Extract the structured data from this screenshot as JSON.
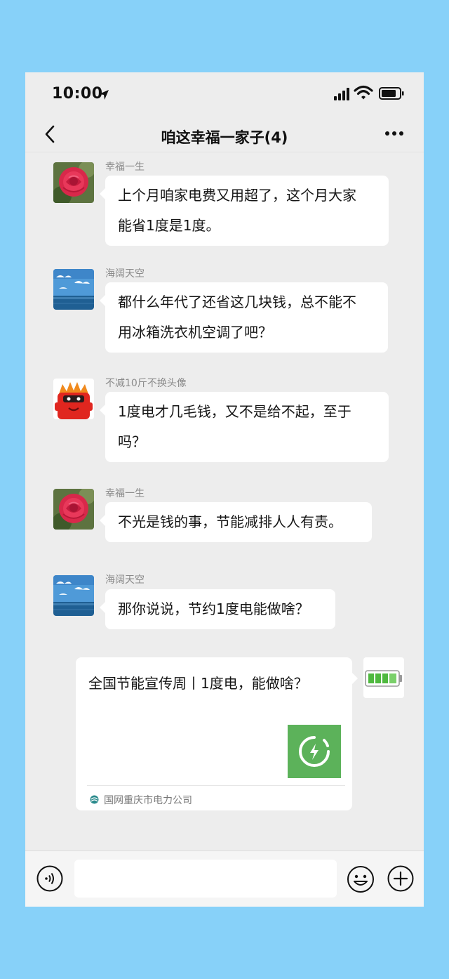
{
  "status_bar": {
    "time": "10:00",
    "icons": [
      "location-arrow-icon",
      "signal-icon",
      "wifi-icon",
      "battery-icon"
    ]
  },
  "header": {
    "title": "咱这幸福一家子(4)",
    "back_icon": "chevron-left-icon",
    "more_icon": "more-dots-icon"
  },
  "messages": [
    {
      "sender": "幸福一生",
      "avatar": "red-rose-avatar",
      "lines": [
        "上个月咱家电费又用超了，这个月大家",
        "能省1度是1度。"
      ]
    },
    {
      "sender": "海阔天空",
      "avatar": "sea-sky-avatar",
      "lines": [
        "都什么年代了还省这几块钱，总不能不",
        "用冰箱洗衣机空调了吧？"
      ]
    },
    {
      "sender": "不减10斤不换头像",
      "avatar": "red-cartoon-avatar",
      "lines": [
        "1度电才几毛钱，又不是给不起，至于",
        "吗？"
      ]
    },
    {
      "sender": "幸福一生",
      "avatar": "red-rose-avatar",
      "lines": [
        "不光是钱的事，节能减排人人有责。"
      ]
    },
    {
      "sender": "海阔天空",
      "avatar": "sea-sky-avatar",
      "lines": [
        "那你说说，节约1度电能做啥？"
      ]
    }
  ],
  "shared_card": {
    "title": "全国节能宣传周丨1度电，能做啥？",
    "source": "国网重庆市电力公司",
    "thumbnail_icon": "lightning-circle-icon",
    "thumbnail_color": "#5cb25a",
    "sender_avatar": "battery-avatar"
  },
  "input_bar": {
    "voice_icon": "voice-icon",
    "placeholder": "",
    "emoji_icon": "emoji-icon",
    "plus_icon": "plus-icon"
  },
  "colors": {
    "page_background": "#87d1f9",
    "chat_background": "#ededed",
    "bubble": "#ffffff"
  }
}
